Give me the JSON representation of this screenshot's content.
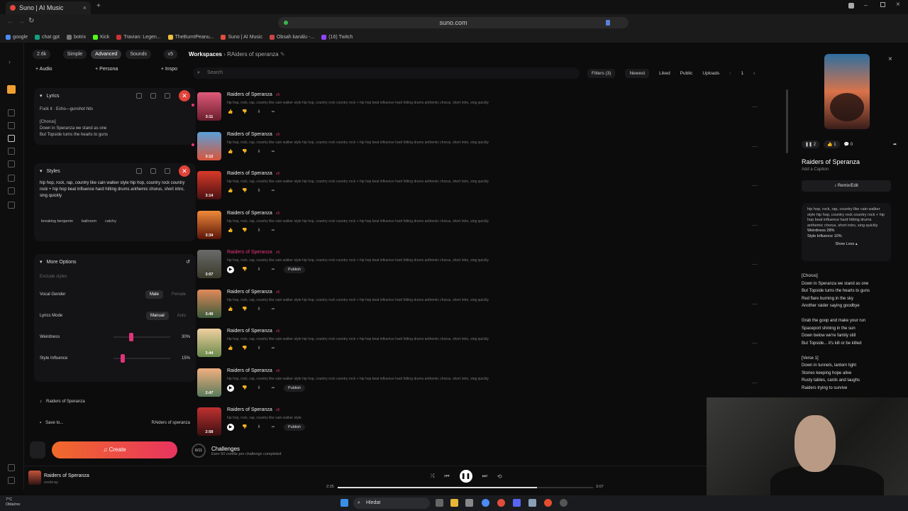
{
  "browser": {
    "tab_title": "Suno | AI Music",
    "url": "suno.com",
    "bookmarks": [
      "google",
      "chat gpt",
      "botrix",
      "Kick",
      "Travian: Legen...",
      "TheBurntPeanu...",
      "Suno | AI Music",
      "Obsah kanálu -...",
      "(16) Twitch"
    ]
  },
  "left": {
    "credits": "2.6k",
    "modes": [
      "Simple",
      "Advanced",
      "Sounds"
    ],
    "version": "v5",
    "add_buttons": [
      "Audio",
      "Persona",
      "Inspo"
    ],
    "lyrics_label": "Lyrics",
    "lyrics_text": "Fuck it · Echo—gunshot hits\n\n[Chorus]\nDown in Speranza we stand as one\nBut Topside turns the hearts to guns",
    "styles_label": "Styles",
    "styles_text": "hip hop, rock, rap, country like cain walker style hip hop, country rock country rock + hip hop beat influence hard hitting drums anthemic chorus, short intro, sing quickly",
    "tags": [
      "breaking benjamin",
      "ballroom",
      "catchy"
    ],
    "more_options": "More Options",
    "exclude_placeholder": "Exclude styles",
    "vocal_gender_label": "Vocal Gender",
    "vocal_male": "Male",
    "vocal_female": "Female",
    "lyrics_mode_label": "Lyrics Mode",
    "lyrics_manual": "Manual",
    "lyrics_auto": "Auto",
    "weirdness_label": "Weirdness",
    "weirdness_value": "30%",
    "style_influence_label": "Style Influence",
    "style_influence_value": "15%",
    "song_title": "Raiders of Speranza",
    "save_to_label": "Save to...",
    "save_to_value": "RAiders of speranza",
    "create_label": "Create"
  },
  "main": {
    "breadcrumb_root": "Workspaces",
    "breadcrumb_current": "RAiders of speranza",
    "search_placeholder": "Search",
    "filters_label": "Filters (3)",
    "sort_label": "Newest",
    "liked_label": "Liked",
    "public_label": "Public",
    "uploads_label": "Uploads",
    "page": "1",
    "songs": [
      {
        "title": "Raiders of Speranza",
        "badge": "v5",
        "duration": "3:11",
        "desc": "hip hop, rock, rap, country like cain walker style hip hop, country rock country rock + hip hop beat influence hard hitting drums anthemic chorus, short intro, sing quickly"
      },
      {
        "title": "Raiders of Speranza",
        "badge": "v5",
        "duration": "3:12",
        "desc": "hip hop, rock, rap, country like cain walker style hip hop, country rock country rock + hip hop beat influence hard hitting drums anthemic chorus, short intro, sing quickly"
      },
      {
        "title": "Raiders of Speranza",
        "badge": "v5",
        "duration": "3:14",
        "desc": "hip hop, rock, rap, country like cain walker style hip hop, country rock country rock + hip hop beat influence hard hitting drums anthemic chorus, short intro, sing quickly"
      },
      {
        "title": "Raiders of Speranza",
        "badge": "v5",
        "duration": "3:34",
        "desc": "hip hop, rock, rap, country like cain walker style hip hop, country rock country rock + hip hop beat influence hard hitting drums anthemic chorus, short intro, sing quickly"
      },
      {
        "title": "Raiders of Speranza",
        "badge": "v5",
        "duration": "3:07",
        "desc": "hip hop, rock, rap, country like cain walker style hip hop, country rock country rock + hip hop beat influence hard hitting drums anthemic chorus, short intro, sing quickly"
      },
      {
        "title": "Raiders of Speranza",
        "badge": "v5",
        "duration": "3:49",
        "desc": "hip hop, rock, rap, country like cain walker style hip hop, country rock country rock + hip hop beat influence hard hitting drums anthemic chorus, short intro, sing quickly"
      },
      {
        "title": "Raiders of Speranza",
        "badge": "v5",
        "duration": "3:44",
        "desc": "hip hop, rock, rap, country like cain walker style hip hop, country rock country rock + hip hop beat influence hard hitting drums anthemic chorus, short intro, sing quickly"
      },
      {
        "title": "Raiders of Speranza",
        "badge": "v5",
        "duration": "2:47",
        "desc": "hip hop, rock, rap, country like cain walker style hip hop, country rock country rock + hip hop beat influence hard hitting drums anthemic chorus, short intro, sing quickly"
      },
      {
        "title": "Raiders of Speranza",
        "badge": "v5",
        "duration": "2:58",
        "desc": "hip hop, rock, rap, country like cain walker style"
      }
    ],
    "publish_label": "Publish",
    "challenges_title": "Challenges",
    "challenges_progress": "6/11",
    "challenges_sub": "Earn 50 credits per challenge completed"
  },
  "right": {
    "play_count": "2",
    "like_count": "1",
    "comment_count": "0",
    "title": "Raiders of Speranza",
    "caption_placeholder": "Add a Caption",
    "remix_label": "Remix/Edit",
    "style_text": "hip hop, rock, rap, country like cain walker style hip hop, country rock country rock + hip hop beat influence hard hitting drums anthemic chorus, short intro, sing quickly",
    "weirdness_text": "Weirdness 28%",
    "influence_text": "Style Influence 10%",
    "show_less": "Show Less",
    "lyrics": "[Chorus]\nDown in Speranza we stand as one\nBut Topside turns the hearts to guns\nRed flare burning in the sky\nAnother raider saying goodbye\n\nGrab the goop and make your run\nSpaceport shining in the sun\nDown below we're family still\nBut Topside... it's kill or be killed\n\n[Verse 1]\nDown in tunnels, lantern light\nStories keeping hope alive\nRusty tables, cards and laughs\nRaiders trying to survive"
  },
  "player": {
    "title": "Raiders of Speranza",
    "artist": "noobray",
    "current_time": "2:25",
    "total_time": "3:07",
    "progress": 0.78
  },
  "taskbar": {
    "weather_temp": "7°C",
    "weather_desc": "Oblačno",
    "search_label": "Hledat"
  },
  "colors": {
    "accent": "#e8347b",
    "create_start": "#f06a2a",
    "create_end": "#e8345f"
  }
}
